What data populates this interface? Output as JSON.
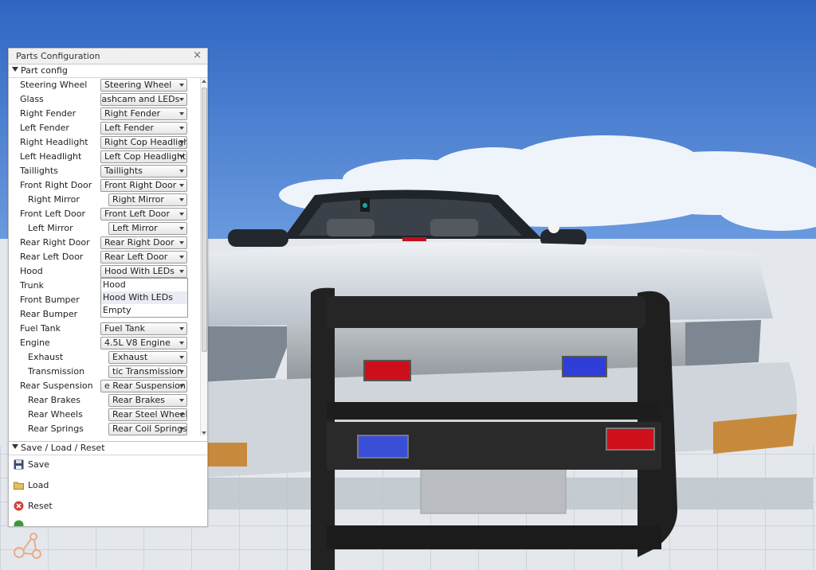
{
  "window": {
    "title": "Parts Configuration",
    "close_glyph": "×"
  },
  "part_config": {
    "section_label": "Part config",
    "rows": [
      {
        "label": "Steering Wheel",
        "value": "Steering Wheel",
        "indent": 0
      },
      {
        "label": "Glass",
        "value": "Dashcam and LEDs",
        "indent": 0,
        "clipped": true
      },
      {
        "label": "Right Fender",
        "value": "Right Fender",
        "indent": 0
      },
      {
        "label": "Left Fender",
        "value": "Left Fender",
        "indent": 0
      },
      {
        "label": "Right Headlight",
        "value": "Right Cop Headlight",
        "indent": 0
      },
      {
        "label": "Left Headlight",
        "value": "Left Cop Headlight",
        "indent": 0
      },
      {
        "label": "Taillights",
        "value": "Taillights",
        "indent": 0
      },
      {
        "label": "Front Right Door",
        "value": "Front Right Door",
        "indent": 0
      },
      {
        "label": "Right Mirror",
        "value": "Right Mirror",
        "indent": 1
      },
      {
        "label": "Front Left Door",
        "value": "Front Left Door",
        "indent": 0
      },
      {
        "label": "Left Mirror",
        "value": "Left Mirror",
        "indent": 1
      },
      {
        "label": "Rear Right Door",
        "value": "Rear Right Door",
        "indent": 0
      },
      {
        "label": "Rear Left Door",
        "value": "Rear Left Door",
        "indent": 0
      },
      {
        "label": "Hood",
        "value": "Hood With LEDs",
        "indent": 0,
        "open": true
      },
      {
        "label": "Trunk",
        "value": "",
        "indent": 0
      },
      {
        "label": "Front Bumper",
        "value": "",
        "indent": 0
      },
      {
        "label": "Rear Bumper",
        "value": "",
        "indent": 0
      },
      {
        "label": "Fuel Tank",
        "value": "Fuel Tank",
        "indent": 0
      },
      {
        "label": "Engine",
        "value": "4.5L V8 Engine",
        "indent": 0
      },
      {
        "label": "Exhaust",
        "value": "Exhaust",
        "indent": 1
      },
      {
        "label": "Transmission",
        "value": "tic Transmission",
        "indent": 1
      },
      {
        "label": "Rear Suspension",
        "value": "e Rear Suspension",
        "indent": 0
      },
      {
        "label": "Rear Brakes",
        "value": "Rear Brakes",
        "indent": 1
      },
      {
        "label": "Rear Wheels",
        "value": "Rear Steel Wheels",
        "indent": 1
      },
      {
        "label": "Rear Springs",
        "value": "Rear Coil Springs",
        "indent": 1
      }
    ],
    "hood_dropdown": {
      "options": [
        "Hood",
        "Hood With LEDs",
        "Empty"
      ],
      "highlighted": "Hood With LEDs"
    }
  },
  "save_load_reset": {
    "section_label": "Save / Load / Reset",
    "actions": [
      {
        "label": "Save",
        "icon": "floppy-disk-icon"
      },
      {
        "label": "Load",
        "icon": "folder-icon"
      },
      {
        "label": "Reset",
        "icon": "red-x-icon"
      }
    ]
  },
  "colors": {
    "sky_top": "#3e72c8",
    "sky_bottom": "#a9c8ee",
    "car_body": "#d7dde4",
    "led_red": "#d0101a",
    "led_blue": "#2d3fd8"
  }
}
